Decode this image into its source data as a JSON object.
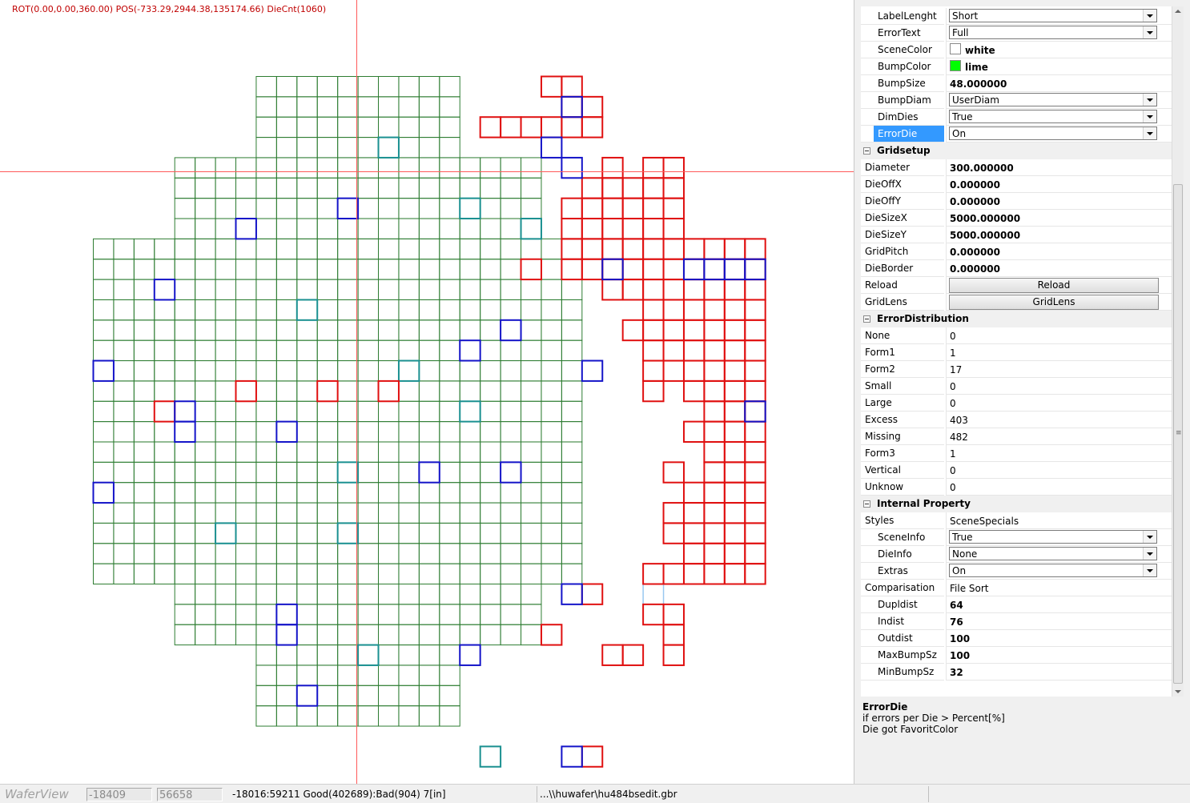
{
  "scene": {
    "info": "ROT(0.00,0.00,360.00) POS(-733.29,2944.38,135174.66) DieCnt(1060)"
  },
  "wafer": {
    "colors": {
      "good": "#2e7d32",
      "error": "#e01010",
      "missing": "#1414c8",
      "excess": "#1a9090",
      "faint": "#99c8f0"
    },
    "row_spans": [
      [
        8,
        17
      ],
      [
        8,
        17
      ],
      [
        8,
        17
      ],
      [
        8,
        17
      ],
      [
        4,
        21
      ],
      [
        4,
        21
      ],
      [
        4,
        21
      ],
      [
        4,
        21
      ],
      [
        0,
        23
      ],
      [
        0,
        23
      ],
      [
        0,
        23
      ],
      [
        0,
        23
      ],
      [
        0,
        23
      ],
      [
        0,
        23
      ],
      [
        0,
        23
      ],
      [
        0,
        23
      ],
      [
        0,
        23
      ],
      [
        0,
        23
      ],
      [
        0,
        23
      ],
      [
        0,
        23
      ],
      [
        0,
        23
      ],
      [
        0,
        23
      ],
      [
        0,
        23
      ],
      [
        0,
        23
      ],
      [
        0,
        23
      ],
      [
        4,
        21
      ],
      [
        4,
        21
      ],
      [
        4,
        21
      ],
      [
        8,
        17
      ],
      [
        8,
        17
      ],
      [
        8,
        17
      ],
      [
        8,
        17
      ]
    ],
    "red_cells": [
      [
        0,
        22
      ],
      [
        0,
        23
      ],
      [
        1,
        23
      ],
      [
        1,
        24
      ],
      [
        2,
        19
      ],
      [
        2,
        20
      ],
      [
        2,
        21
      ],
      [
        2,
        22
      ],
      [
        2,
        23
      ],
      [
        2,
        24
      ],
      [
        4,
        25
      ],
      [
        4,
        27
      ],
      [
        4,
        28
      ],
      [
        5,
        24
      ],
      [
        5,
        25
      ],
      [
        5,
        26
      ],
      [
        5,
        27
      ],
      [
        5,
        28
      ],
      [
        6,
        23
      ],
      [
        6,
        24
      ],
      [
        6,
        25
      ],
      [
        6,
        26
      ],
      [
        6,
        27
      ],
      [
        6,
        28
      ],
      [
        7,
        23
      ],
      [
        7,
        24
      ],
      [
        7,
        25
      ],
      [
        7,
        26
      ],
      [
        7,
        27
      ],
      [
        7,
        28
      ],
      [
        8,
        23
      ],
      [
        8,
        24
      ],
      [
        8,
        25
      ],
      [
        8,
        26
      ],
      [
        8,
        27
      ],
      [
        8,
        28
      ],
      [
        8,
        29
      ],
      [
        8,
        30
      ],
      [
        8,
        31
      ],
      [
        8,
        32
      ],
      [
        9,
        21
      ],
      [
        9,
        23
      ],
      [
        9,
        24
      ],
      [
        9,
        25
      ],
      [
        9,
        26
      ],
      [
        9,
        27
      ],
      [
        9,
        28
      ],
      [
        9,
        29
      ],
      [
        9,
        30
      ],
      [
        9,
        31
      ],
      [
        9,
        32
      ],
      [
        10,
        25
      ],
      [
        10,
        26
      ],
      [
        10,
        27
      ],
      [
        10,
        28
      ],
      [
        10,
        29
      ],
      [
        10,
        30
      ],
      [
        10,
        31
      ],
      [
        10,
        32
      ],
      [
        11,
        27
      ],
      [
        11,
        28
      ],
      [
        11,
        29
      ],
      [
        11,
        30
      ],
      [
        11,
        31
      ],
      [
        11,
        32
      ],
      [
        12,
        26
      ],
      [
        12,
        27
      ],
      [
        12,
        28
      ],
      [
        12,
        29
      ],
      [
        12,
        30
      ],
      [
        12,
        31
      ],
      [
        12,
        32
      ],
      [
        13,
        27
      ],
      [
        13,
        28
      ],
      [
        13,
        29
      ],
      [
        13,
        30
      ],
      [
        13,
        31
      ],
      [
        13,
        32
      ],
      [
        14,
        27
      ],
      [
        14,
        28
      ],
      [
        14,
        29
      ],
      [
        14,
        30
      ],
      [
        14,
        31
      ],
      [
        14,
        32
      ],
      [
        15,
        7
      ],
      [
        15,
        11
      ],
      [
        15,
        14
      ],
      [
        15,
        27
      ],
      [
        15,
        29
      ],
      [
        15,
        30
      ],
      [
        15,
        31
      ],
      [
        15,
        32
      ],
      [
        16,
        3
      ],
      [
        16,
        30
      ],
      [
        16,
        31
      ],
      [
        16,
        32
      ],
      [
        17,
        29
      ],
      [
        17,
        30
      ],
      [
        17,
        31
      ],
      [
        17,
        32
      ],
      [
        18,
        30
      ],
      [
        18,
        31
      ],
      [
        18,
        32
      ],
      [
        19,
        28
      ],
      [
        19,
        30
      ],
      [
        19,
        31
      ],
      [
        19,
        32
      ],
      [
        20,
        29
      ],
      [
        20,
        30
      ],
      [
        20,
        31
      ],
      [
        20,
        32
      ],
      [
        21,
        28
      ],
      [
        21,
        29
      ],
      [
        21,
        30
      ],
      [
        21,
        31
      ],
      [
        21,
        32
      ],
      [
        22,
        28
      ],
      [
        22,
        29
      ],
      [
        22,
        30
      ],
      [
        22,
        31
      ],
      [
        22,
        32
      ],
      [
        23,
        29
      ],
      [
        23,
        30
      ],
      [
        23,
        31
      ],
      [
        23,
        32
      ],
      [
        24,
        27
      ],
      [
        24,
        28
      ],
      [
        24,
        29
      ],
      [
        24,
        30
      ],
      [
        24,
        31
      ],
      [
        24,
        32
      ],
      [
        25,
        24
      ],
      [
        26,
        27
      ],
      [
        26,
        28
      ],
      [
        27,
        22
      ],
      [
        27,
        28
      ],
      [
        28,
        25
      ],
      [
        28,
        26
      ],
      [
        28,
        28
      ],
      [
        33,
        24
      ]
    ],
    "blue_cells": [
      [
        1,
        23
      ],
      [
        3,
        22
      ],
      [
        4,
        23
      ],
      [
        6,
        12
      ],
      [
        7,
        7
      ],
      [
        9,
        25
      ],
      [
        9,
        29
      ],
      [
        9,
        30
      ],
      [
        9,
        31
      ],
      [
        9,
        32
      ],
      [
        10,
        3
      ],
      [
        12,
        20
      ],
      [
        13,
        18
      ],
      [
        14,
        0
      ],
      [
        14,
        24
      ],
      [
        16,
        4
      ],
      [
        16,
        32
      ],
      [
        17,
        4
      ],
      [
        17,
        9
      ],
      [
        19,
        16
      ],
      [
        19,
        20
      ],
      [
        20,
        0
      ],
      [
        25,
        23
      ],
      [
        26,
        9
      ],
      [
        27,
        9
      ],
      [
        28,
        18
      ],
      [
        30,
        10
      ],
      [
        33,
        23
      ]
    ],
    "teal_cells": [
      [
        3,
        14
      ],
      [
        6,
        18
      ],
      [
        7,
        21
      ],
      [
        11,
        10
      ],
      [
        14,
        15
      ],
      [
        16,
        18
      ],
      [
        19,
        12
      ],
      [
        22,
        6
      ],
      [
        22,
        12
      ],
      [
        28,
        13
      ],
      [
        33,
        19
      ]
    ],
    "faint_cells": [
      [
        25,
        27
      ]
    ]
  },
  "panel": {
    "rows": [
      {
        "label": "LabelLenght",
        "indent": 2,
        "type": "dropdown",
        "value": "Short"
      },
      {
        "label": "ErrorText",
        "indent": 2,
        "type": "dropdown",
        "value": "Full"
      },
      {
        "label": "SceneColor",
        "indent": 2,
        "type": "color",
        "swatch": "#ffffff",
        "value": "white"
      },
      {
        "label": "BumpColor",
        "indent": 2,
        "type": "color",
        "swatch": "#00ff00",
        "value": "lime"
      },
      {
        "label": "BumpSize",
        "indent": 2,
        "type": "text",
        "bold": true,
        "value": "48.000000"
      },
      {
        "label": "BumpDiam",
        "indent": 2,
        "type": "dropdown",
        "value": "UserDiam"
      },
      {
        "label": "DimDies",
        "indent": 2,
        "type": "dropdown",
        "value": "True"
      },
      {
        "label": "ErrorDie",
        "indent": 2,
        "type": "dropdown",
        "value": "On",
        "selected": true
      },
      {
        "label": "Gridsetup",
        "type": "category"
      },
      {
        "label": "Diameter",
        "indent": 1,
        "type": "text",
        "bold": true,
        "value": "300.000000"
      },
      {
        "label": "DieOffX",
        "indent": 1,
        "type": "text",
        "bold": true,
        "value": "0.000000"
      },
      {
        "label": "DieOffY",
        "indent": 1,
        "type": "text",
        "bold": true,
        "value": "0.000000"
      },
      {
        "label": "DieSizeX",
        "indent": 1,
        "type": "text",
        "bold": true,
        "value": "5000.000000"
      },
      {
        "label": "DieSizeY",
        "indent": 1,
        "type": "text",
        "bold": true,
        "value": "5000.000000"
      },
      {
        "label": "GridPitch",
        "indent": 1,
        "type": "text",
        "bold": true,
        "value": "0.000000"
      },
      {
        "label": "DieBorder",
        "indent": 1,
        "type": "text",
        "bold": true,
        "value": "0.000000"
      },
      {
        "label": "Reload",
        "indent": 1,
        "type": "button",
        "value": "Reload"
      },
      {
        "label": "GridLens",
        "indent": 1,
        "type": "button",
        "value": "GridLens"
      },
      {
        "label": "ErrorDistribution",
        "type": "category"
      },
      {
        "label": "None",
        "indent": 1,
        "type": "text",
        "value": "0"
      },
      {
        "label": "Form1",
        "indent": 1,
        "type": "text",
        "value": "1"
      },
      {
        "label": "Form2",
        "indent": 1,
        "type": "text",
        "value": "17"
      },
      {
        "label": "Small",
        "indent": 1,
        "type": "text",
        "value": "0"
      },
      {
        "label": "Large",
        "indent": 1,
        "type": "text",
        "value": "0"
      },
      {
        "label": "Excess",
        "indent": 1,
        "type": "text",
        "value": "403"
      },
      {
        "label": "Missing",
        "indent": 1,
        "type": "text",
        "value": "482"
      },
      {
        "label": "Form3",
        "indent": 1,
        "type": "text",
        "value": "1"
      },
      {
        "label": "Vertical",
        "indent": 1,
        "type": "text",
        "value": "0"
      },
      {
        "label": "Unknow",
        "indent": 1,
        "type": "text",
        "value": "0"
      },
      {
        "label": "Internal Property",
        "type": "category"
      },
      {
        "label": "Styles",
        "indent": 1,
        "type": "text",
        "value": "SceneSpecials",
        "toggle": true
      },
      {
        "label": "SceneInfo",
        "indent": 2,
        "type": "dropdown",
        "value": "True"
      },
      {
        "label": "DieInfo",
        "indent": 2,
        "type": "dropdown",
        "value": "None"
      },
      {
        "label": "Extras",
        "indent": 2,
        "type": "dropdown",
        "value": "On"
      },
      {
        "label": "Comparisation",
        "indent": 1,
        "type": "text",
        "value": "File Sort",
        "toggle": true
      },
      {
        "label": "Dupldist",
        "indent": 2,
        "type": "text",
        "bold": true,
        "value": "64"
      },
      {
        "label": "Indist",
        "indent": 2,
        "type": "text",
        "bold": true,
        "value": "76"
      },
      {
        "label": "Outdist",
        "indent": 2,
        "type": "text",
        "bold": true,
        "value": "100"
      },
      {
        "label": "MaxBumpSz",
        "indent": 2,
        "type": "text",
        "bold": true,
        "value": "100"
      },
      {
        "label": "MinBumpSz",
        "indent": 2,
        "type": "text",
        "bold": true,
        "value": "32"
      }
    ],
    "description": {
      "title": "ErrorDie",
      "line1": "if errors per Die > Percent[%]",
      "line2": "Die got FavoritColor"
    }
  },
  "statusbar": {
    "app_name": "WaferView",
    "coord_x": "-18409",
    "coord_y": "56658",
    "stats": "-18016:59211 Good(402689):Bad(904) 7[in]",
    "file": "...\\\\huwafer\\hu484bsedit.gbr"
  }
}
